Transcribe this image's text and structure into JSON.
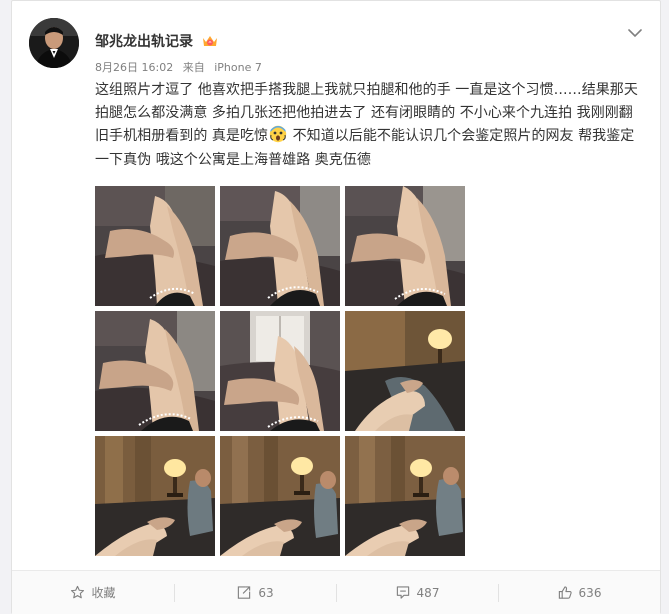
{
  "post": {
    "author": "邹兆龙出轨记录",
    "meta": {
      "timestamp": "8月26日 16:02",
      "source_prefix": "来自",
      "device": "iPhone 7"
    },
    "text_parts": [
      "这组照片才逗了 他喜欢把手搭我腿上我就只拍腿和他的手 一直是这个习惯……结果那天拍腿怎么都没满意 多拍几张还把他拍进去了 还有闭眼睛的 不小心来个九连拍 我刚刚翻旧手机相册看到的 真是吃惊",
      " 不知道以后能不能认识几个会鉴定照片的网友 帮我鉴定一下真伪 哦这个公寓是上海普雄路 奥克伍德"
    ],
    "images": [
      {
        "scene": "couch-legs-hand"
      },
      {
        "scene": "couch-legs-hand"
      },
      {
        "scene": "couch-legs-hand"
      },
      {
        "scene": "couch-legs-hand"
      },
      {
        "scene": "couch-legs-hand-window"
      },
      {
        "scene": "feet-lamp"
      },
      {
        "scene": "lamp-man-feet"
      },
      {
        "scene": "lamp-man-feet"
      },
      {
        "scene": "lamp-man-feet"
      }
    ]
  },
  "actions": {
    "favorite_label": "收藏",
    "repost_count": "63",
    "comment_count": "487",
    "like_count": "636"
  },
  "colors": {
    "accent_orange": "#fa7d3c",
    "muted_text": "#808080",
    "body_text": "#333333"
  }
}
